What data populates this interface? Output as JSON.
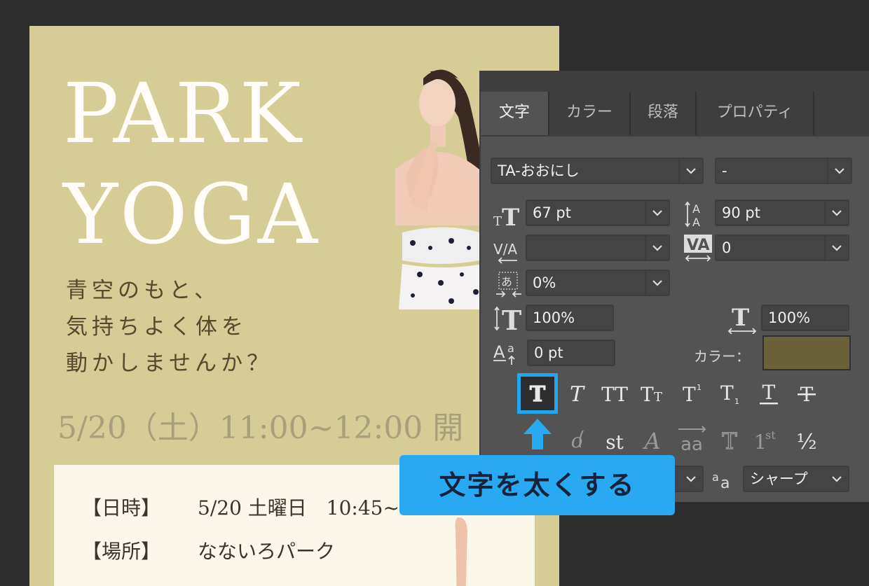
{
  "poster": {
    "title_line1": "PARK",
    "title_line2": "YOGA",
    "tagline": [
      "青空のもと、",
      "気持ちよく体を",
      "動かしませんか？"
    ],
    "event_date": "5/20（土）11:00~12:00 開",
    "info": [
      {
        "label": "【日時】",
        "value": "5/20 土曜日　10:45~"
      },
      {
        "label": "【場所】",
        "value": "なないろパーク"
      }
    ]
  },
  "panel": {
    "tabs": [
      "文字",
      "カラー",
      "段落",
      "プロパティ"
    ],
    "active_tab": "文字",
    "font_family": "TA-おおにし",
    "font_style": "-",
    "font_size": "67 pt",
    "leading": "90 pt",
    "kerning": "",
    "tracking": "0",
    "tsume": "0%",
    "vertical_scale": "100%",
    "horizontal_scale": "100%",
    "baseline_shift": "0 pt",
    "color_label": "カラー：",
    "text_color": "#6b6138",
    "antialias": "シャープ",
    "ot_fraction": "½"
  },
  "callout": {
    "text": "文字を太くする",
    "color": "#29a9f2"
  }
}
